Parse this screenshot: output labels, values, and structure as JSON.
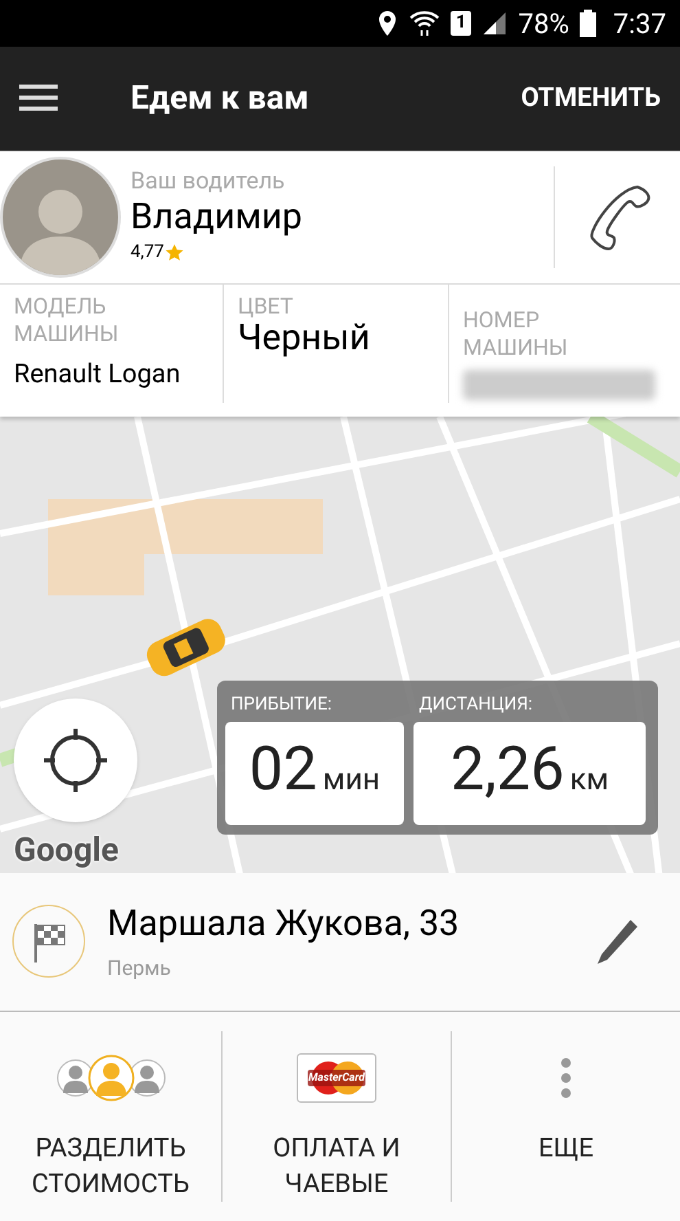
{
  "status_bar": {
    "sim": "1",
    "battery": "78%",
    "time": "7:37"
  },
  "app_bar": {
    "title": "Едем к вам",
    "action": "ОТМЕНИТЬ"
  },
  "driver": {
    "caption": "Ваш водитель",
    "name": "Владимир",
    "rating": "4,77"
  },
  "car_info": [
    {
      "kind": "text",
      "label": "МОДЕЛЬ МАШИНЫ",
      "value": "Renault Logan"
    },
    {
      "kind": "text",
      "label": "ЦВЕТ",
      "value": "Черный"
    },
    {
      "kind": "hidden",
      "label": "НОМЕР МАШИНЫ"
    }
  ],
  "map": {
    "attribution": "Google"
  },
  "eta": {
    "arrival_label": "ПРИБЫТИЕ:",
    "arrival_value": "02",
    "arrival_unit": "мин",
    "distance_label": "ДИСТАНЦИЯ:",
    "distance_value": "2,26",
    "distance_unit": "км"
  },
  "destination": {
    "address": "Маршала Жукова, 33",
    "city": "Пермь"
  },
  "actions": [
    {
      "kind": "split",
      "label": "РАЗДЕЛИТЬ СТОИМОСТЬ"
    },
    {
      "kind": "card",
      "label": "ОПЛАТА И ЧАЕВЫЕ",
      "card_text": "MasterCard"
    },
    {
      "kind": "more",
      "label": "ЕЩЕ"
    }
  ]
}
